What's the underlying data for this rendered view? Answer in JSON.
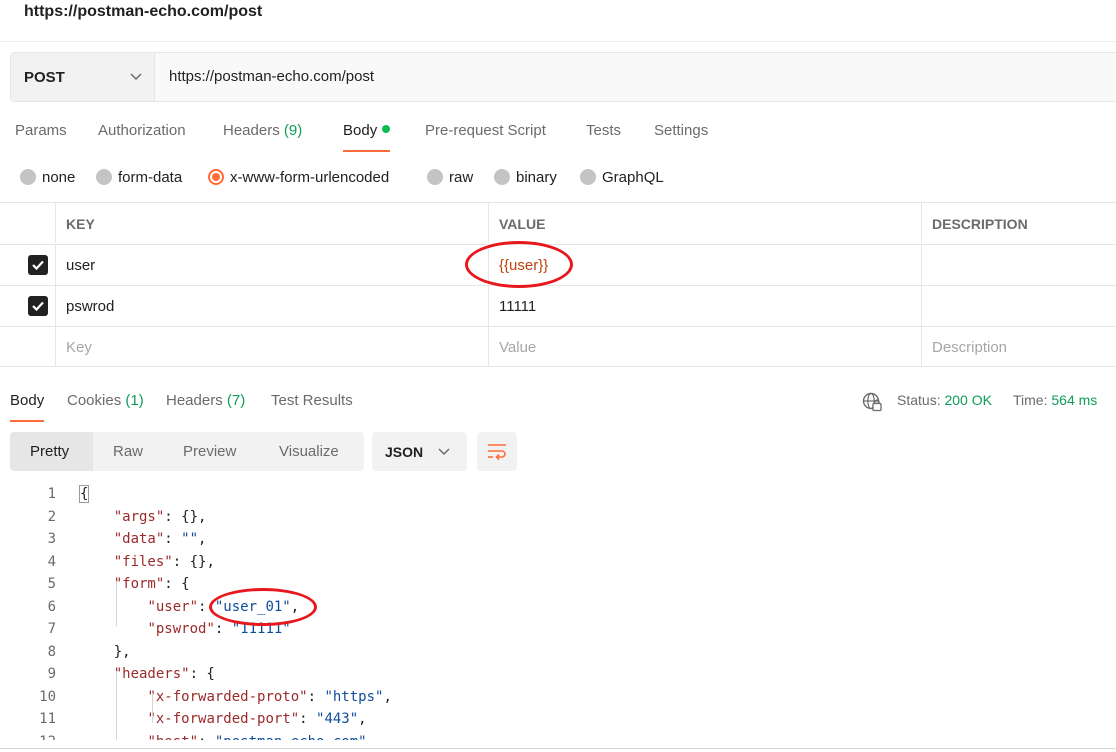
{
  "window": {
    "title": "https://postman-echo.com/post"
  },
  "request": {
    "method": "POST",
    "url": "https://postman-echo.com/post",
    "tabs": [
      {
        "label": "Params"
      },
      {
        "label": "Authorization"
      },
      {
        "label": "Headers",
        "count": "(9)"
      },
      {
        "label": "Body",
        "indicator": "green-dot"
      },
      {
        "label": "Pre-request Script"
      },
      {
        "label": "Tests"
      },
      {
        "label": "Settings"
      }
    ],
    "active_tab": "Body",
    "body_types": [
      "none",
      "form-data",
      "x-www-form-urlencoded",
      "raw",
      "binary",
      "GraphQL"
    ],
    "selected_body_type": "x-www-form-urlencoded",
    "table": {
      "columns": [
        "KEY",
        "VALUE",
        "DESCRIPTION"
      ],
      "rows": [
        {
          "checked": true,
          "key": "user",
          "value": "{{user}}",
          "description": ""
        },
        {
          "checked": true,
          "key": "pswrod",
          "value": "11111",
          "description": ""
        }
      ],
      "placeholders": {
        "key": "Key",
        "value": "Value",
        "description": "Description"
      }
    }
  },
  "response": {
    "tabs": [
      {
        "label": "Body"
      },
      {
        "label": "Cookies",
        "count": "(1)"
      },
      {
        "label": "Headers",
        "count": "(7)"
      },
      {
        "label": "Test Results"
      }
    ],
    "active_tab": "Body",
    "status_label": "Status:",
    "status_value": "200 OK",
    "time_label": "Time:",
    "time_value": "564 ms",
    "view_modes": [
      "Pretty",
      "Raw",
      "Preview",
      "Visualize"
    ],
    "active_view": "Pretty",
    "format": "JSON",
    "code_lines": [
      "{",
      "    \"args\": {},",
      "    \"data\": \"\",",
      "    \"files\": {},",
      "    \"form\": {",
      "        \"user\": \"user_01\",",
      "        \"pswrod\": \"11111\"",
      "    },",
      "    \"headers\": {",
      "        \"x-forwarded-proto\": \"https\",",
      "        \"x-forwarded-port\": \"443\",",
      "        \"host\": \"postman-echo.com\","
    ]
  },
  "icons": {
    "method_dropdown": "chevron-down-icon",
    "format_dropdown": "chevron-down-icon",
    "wrap": "wrap-lines-icon",
    "network": "globe-lock-icon",
    "checkbox": "checkbox-checked-icon"
  },
  "colors": {
    "accent": "#ff6c37",
    "success": "#0f9d58",
    "annotation": "#e8161d",
    "json_key": "#9c2a2a",
    "json_string": "#0f4c9c"
  }
}
